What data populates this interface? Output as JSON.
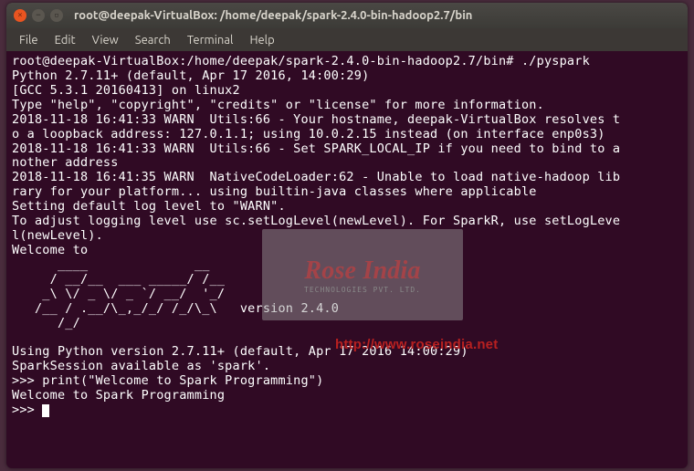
{
  "titlebar": {
    "title": "root@deepak-VirtualBox: /home/deepak/spark-2.4.0-bin-hadoop2.7/bin"
  },
  "menubar": {
    "items": [
      "File",
      "Edit",
      "View",
      "Search",
      "Terminal",
      "Help"
    ]
  },
  "terminal": {
    "lines": [
      "root@deepak-VirtualBox:/home/deepak/spark-2.4.0-bin-hadoop2.7/bin# ./pyspark",
      "Python 2.7.11+ (default, Apr 17 2016, 14:00:29)",
      "[GCC 5.3.1 20160413] on linux2",
      "Type \"help\", \"copyright\", \"credits\" or \"license\" for more information.",
      "2018-11-18 16:41:33 WARN  Utils:66 - Your hostname, deepak-VirtualBox resolves t",
      "o a loopback address: 127.0.1.1; using 10.0.2.15 instead (on interface enp0s3)",
      "2018-11-18 16:41:33 WARN  Utils:66 - Set SPARK_LOCAL_IP if you need to bind to a",
      "nother address",
      "2018-11-18 16:41:35 WARN  NativeCodeLoader:62 - Unable to load native-hadoop lib",
      "rary for your platform... using builtin-java classes where applicable",
      "Setting default log level to \"WARN\".",
      "To adjust logging level use sc.setLogLevel(newLevel). For SparkR, use setLogLeve",
      "l(newLevel).",
      "Welcome to",
      "      ____              __",
      "     / __/__  ___ _____/ /__",
      "    _\\ \\/ _ \\/ _ `/ __/  '_/",
      "   /__ / .__/\\_,_/_/ /_/\\_\\   version 2.4.0",
      "      /_/",
      "",
      "Using Python version 2.7.11+ (default, Apr 17 2016 14:00:29)",
      "SparkSession available as 'spark'.",
      ">>> print(\"Welcome to Spark Programming\")",
      "Welcome to Spark Programming",
      ">>> "
    ]
  },
  "watermark": {
    "main": "Rose India",
    "sub": "TECHNOLOGIES PVT. LTD.",
    "url": "http://www.roseindia.net"
  }
}
